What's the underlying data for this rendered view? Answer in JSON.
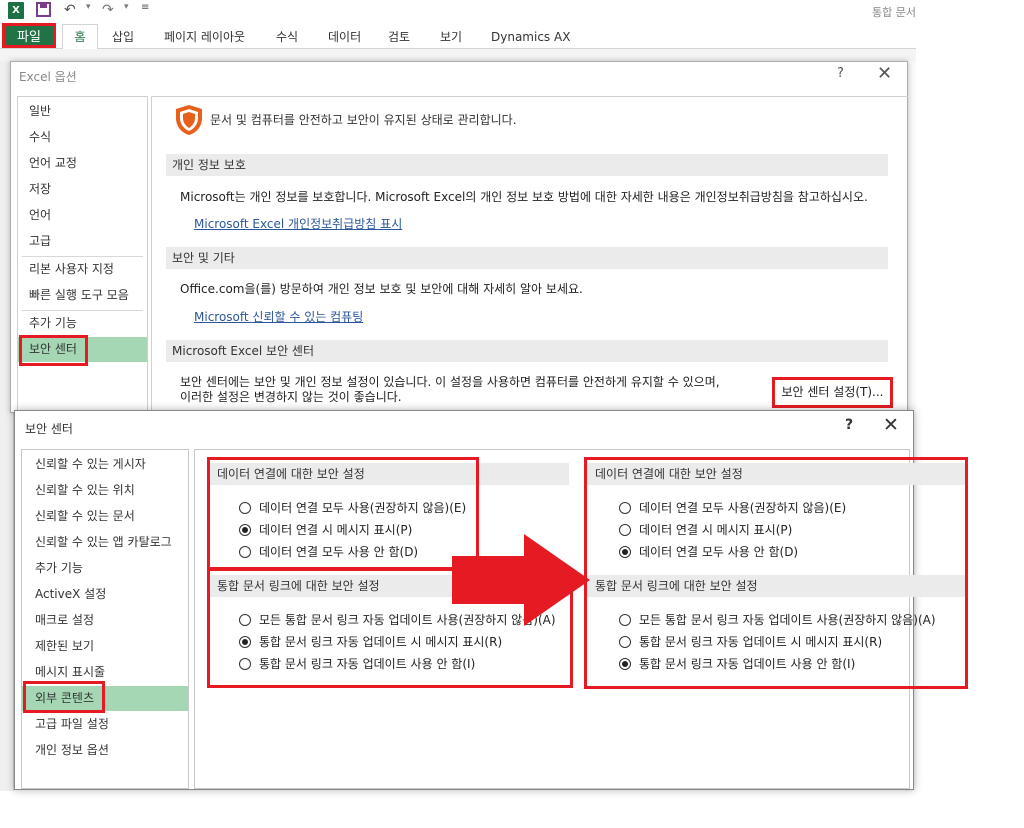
{
  "colors": {
    "excel_green": "#217346",
    "highlight_red": "#e51a22",
    "nav_selected": "#a5d7b4",
    "link_blue": "#2b579a",
    "shield_orange": "#e8601c"
  },
  "qat": {
    "excel_icon_label": "X",
    "window_title": "통합 문서"
  },
  "ribbon_tabs": {
    "file": "파일",
    "items": [
      "홈",
      "삽입",
      "페이지 레이아웃",
      "수식",
      "데이터",
      "검토",
      "보기",
      "Dynamics AX"
    ]
  },
  "excel_options": {
    "title": "Excel 옵션",
    "help": "?",
    "close": "✕",
    "nav": [
      "일반",
      "수식",
      "언어 교정",
      "저장",
      "언어",
      "고급",
      "리본 사용자 지정",
      "빠른 실행 도구 모음",
      "추가 기능",
      "보안 센터"
    ],
    "selected_nav": "보안 센터",
    "heading": "문서 및 컴퓨터를 안전하고 보안이 유지된 상태로 관리합니다.",
    "privacy": {
      "title": "개인 정보 보호",
      "text": "Microsoft는 개인 정보를 보호합니다. Microsoft Excel의 개인 정보 보호 방법에 대한 자세한 내용은 개인정보취급방침을 참고하십시오.",
      "link": "Microsoft Excel 개인정보취급방침 표시"
    },
    "security_other": {
      "title": "보안 및 기타",
      "text": "Office.com을(를) 방문하여 개인 정보 보호 및 보안에 대해 자세히 알아 보세요.",
      "link": "Microsoft 신뢰할 수 있는 컴퓨팅"
    },
    "trust_center": {
      "title": "Microsoft Excel 보안 센터",
      "text_line1": "보안 센터에는 보안 및 개인 정보 설정이 있습니다. 이 설정을 사용하면 컴퓨터를 안전하게 유지할 수 있으며,",
      "text_line2": "이러한 설정은 변경하지 않는 것이 좋습니다.",
      "button": "보안 센터 설정(T)..."
    }
  },
  "trust_center_dialog": {
    "title": "보안 센터",
    "help": "?",
    "close": "✕",
    "nav": [
      "신뢰할 수 있는 게시자",
      "신뢰할 수 있는 위치",
      "신뢰할 수 있는 문서",
      "신뢰할 수 있는 앱 카탈로그",
      "추가 기능",
      "ActiveX 설정",
      "매크로 설정",
      "제한된 보기",
      "메시지 표시줄",
      "외부 콘텐츠",
      "고급 파일 설정",
      "개인 정보 옵션"
    ],
    "selected_nav": "외부 콘텐츠",
    "before": {
      "data_connections": {
        "title": "데이터 연결에 대한 보안 설정",
        "options": [
          "데이터 연결 모두 사용(권장하지 않음)(E)",
          "데이터 연결 시 메시지 표시(P)",
          "데이터 연결 모두 사용 안 함(D)"
        ],
        "selected_index": 1
      },
      "workbook_links": {
        "title": "통합 문서 링크에 대한 보안 설정",
        "options": [
          "모든 통합 문서 링크 자동 업데이트 사용(권장하지 않음)(A)",
          "통합 문서 링크 자동 업데이트 시 메시지 표시(R)",
          "통합 문서 링크 자동 업데이트 사용 안 함(I)"
        ],
        "selected_index": 1
      }
    },
    "after": {
      "data_connections": {
        "title": "데이터 연결에 대한 보안 설정",
        "options": [
          "데이터 연결 모두 사용(권장하지 않음)(E)",
          "데이터 연결 시 메시지 표시(P)",
          "데이터 연결 모두 사용 안 함(D)"
        ],
        "selected_index": 2
      },
      "workbook_links": {
        "title": "통합 문서 링크에 대한 보안 설정",
        "options": [
          "모든 통합 문서 링크 자동 업데이트 사용(권장하지 않음)(A)",
          "통합 문서 링크 자동 업데이트 시 메시지 표시(R)",
          "통합 문서 링크 자동 업데이트 사용 안 함(I)"
        ],
        "selected_index": 2
      }
    }
  }
}
